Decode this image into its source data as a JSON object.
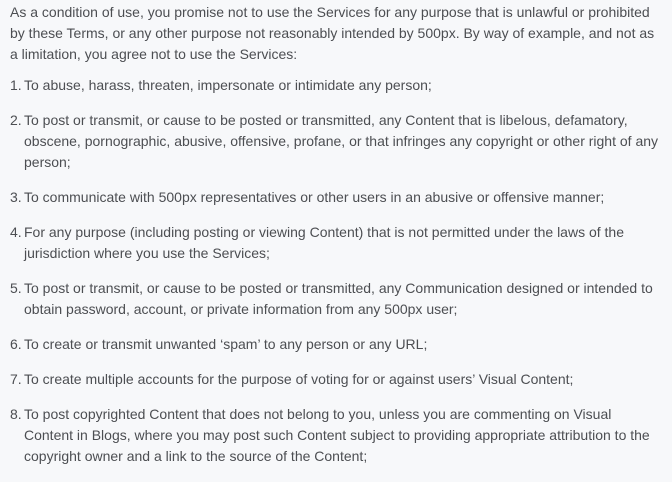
{
  "intro": "As a condition of use, you promise not to use the Services for any purpose that is unlawful or prohibited by these Terms, or any other purpose not reasonably intended by 500px. By way of example, and not as a limitation, you agree not to use the Services:",
  "items": [
    {
      "num": "1.",
      "text": "To abuse, harass, threaten, impersonate or intimidate any person;"
    },
    {
      "num": "2.",
      "text": "To post or transmit, or cause to be posted or transmitted, any Content that is libelous, defamatory, obscene, pornographic, abusive, offensive, profane, or that infringes any copyright or other right of any person;"
    },
    {
      "num": "3.",
      "text": "To communicate with 500px representatives or other users in an abusive or offensive manner;"
    },
    {
      "num": "4.",
      "text": "For any purpose (including posting or viewing Content) that is not permitted under the laws of the jurisdiction where you use the Services;"
    },
    {
      "num": "5.",
      "text": "To post or transmit, or cause to be posted or transmitted, any Communication designed or intended to obtain password, account, or private information from any 500px user;"
    },
    {
      "num": "6.",
      "text": "To create or transmit unwanted ‘spam’ to any person or any URL;"
    },
    {
      "num": "7.",
      "text": "To create multiple accounts for the purpose of voting for or against users’ Visual Content;"
    },
    {
      "num": "8.",
      "text": "To post copyrighted Content that does not belong to you, unless you are commenting on Visual Content in Blogs, where you may post such Content subject to providing appropriate attribution to the copyright owner and a link to the source of the Content;"
    }
  ]
}
